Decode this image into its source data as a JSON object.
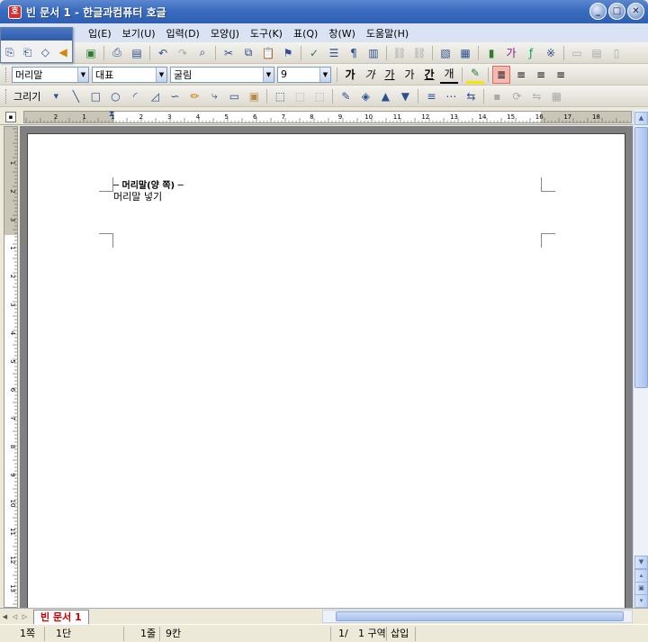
{
  "window": {
    "title": "빈 문서 1 - 한글과컴퓨터 호글",
    "app_icon": "호",
    "minimize": "_",
    "maximize": "□",
    "close": "✕"
  },
  "menu": [
    "입(E)",
    "보기(U)",
    "입력(D)",
    "모양(J)",
    "도구(K)",
    "표(Q)",
    "창(W)",
    "도움말(H)"
  ],
  "formatting": {
    "style_value": "머리말",
    "lang_value": "대표",
    "font_value": "굴림",
    "size_value": "9",
    "bold_glyph": "가",
    "italic_glyph": "가",
    "underline_glyph": "가",
    "strike_glyph": "가",
    "outline_glyph": "간",
    "font_color_glyph": "개"
  },
  "drawing": {
    "label": "그리기"
  },
  "ruler_ticks": [
    "2",
    "1",
    "1",
    "2",
    "3",
    "4",
    "5",
    "6",
    "7",
    "8",
    "9",
    "10",
    "11",
    "12",
    "13",
    "14",
    "15",
    "16",
    "17",
    "18"
  ],
  "vruler_ticks": [
    "1",
    "2",
    "3",
    "1",
    "2",
    "3",
    "4",
    "5",
    "6",
    "7",
    "8",
    "9",
    "10",
    "11",
    "12",
    "13",
    "14"
  ],
  "document": {
    "header_title": "─ 머리말(양 쪽) ─",
    "header_text": "머리말 넣기"
  },
  "tabs": {
    "current": "빈 문서 1"
  },
  "status": {
    "page": "1쪽",
    "column": "1단",
    "line": "1줄",
    "char": "9칸",
    "section_page": "1/",
    "section": "1 구역",
    "mode": "삽입"
  },
  "colors": {
    "title_bar": "#3a6cc0",
    "menu_bar": "#d9e3f3",
    "tab_text": "#cc0000",
    "highlight_yellow": "#f5e600"
  }
}
